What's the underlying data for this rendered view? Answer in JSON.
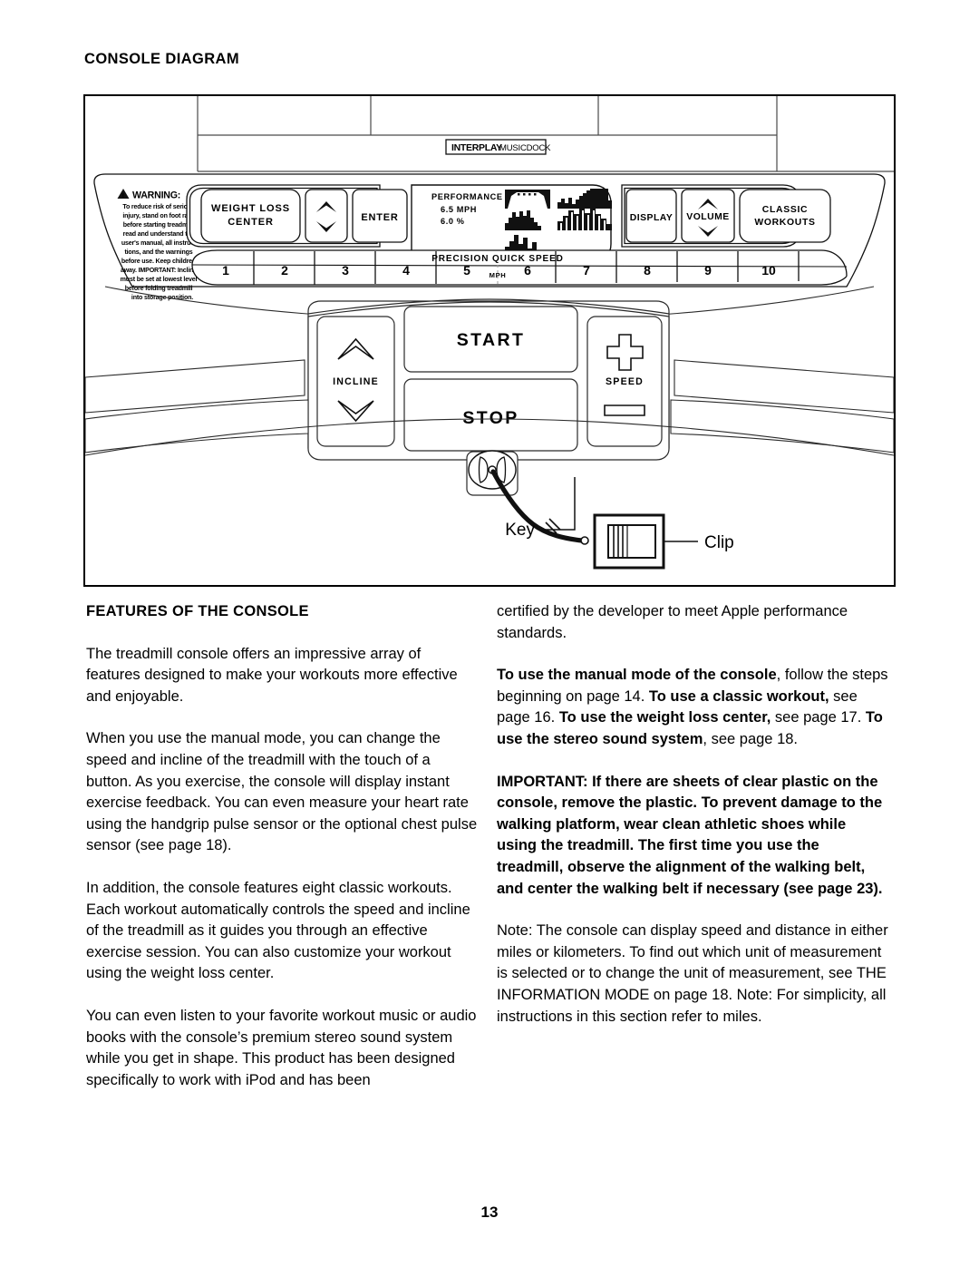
{
  "section_title": "CONSOLE DIAGRAM",
  "page_number": "13",
  "diagram": {
    "brand_logo": {
      "primary": "INTERPLAY",
      "secondary": "MUSICDOCK"
    },
    "warning": {
      "title": "WARNING:",
      "body": "To reduce risk of serious injury, stand on foot rails before starting treadmill, read and understand the user's manual, all instructions, and the warnings before use. Keep children away. IMPORTANT: Incline must be set at lowest level before folding treadmill into storage position.",
      "lines": [
        "To reduce risk of serious",
        "injury, stand on foot rails",
        "before starting treadmill,",
        "read and understand the",
        "user's manual, all instruc-",
        "tions, and the warnings",
        "before use.  Keep children",
        "away.  IMPORTANT: Incline",
        "must be set at lowest level",
        "before folding treadmill",
        "into storage position."
      ]
    },
    "buttons": {
      "weight_loss_center_line1": "WEIGHT LOSS",
      "weight_loss_center_line2": "CENTER",
      "enter": "ENTER",
      "display": "DISPLAY",
      "volume": "VOLUME",
      "classic_workouts_line1": "CLASSIC",
      "classic_workouts_line2": "WORKOUTS",
      "start": "START",
      "stop": "STOP",
      "incline": "INCLINE",
      "speed": "SPEED"
    },
    "display_screen": {
      "mode_label": "PERFORMANCE",
      "speed_value": "6.5 MPH",
      "incline_value": "6.0 %"
    },
    "quick_speed": {
      "label": "PRECISION QUICK SPEED",
      "unit": "MPH",
      "keys": [
        "1",
        "2",
        "3",
        "4",
        "5",
        "6",
        "7",
        "8",
        "9",
        "10"
      ]
    },
    "callouts": {
      "key": "Key",
      "clip": "Clip"
    }
  },
  "content": {
    "left_heading": "FEATURES OF THE CONSOLE",
    "left_paragraphs": [
      "The treadmill console offers an impressive array of features designed to make your workouts more effective and enjoyable.",
      "When you use the manual mode, you can change the speed and incline of the treadmill with the touch of a button. As you exercise, the console will display instant exercise feedback. You can even measure your heart rate using the handgrip pulse sensor or the optional chest pulse sensor (see page 18).",
      "In addition, the console features eight classic workouts. Each workout automatically controls the speed and incline of the treadmill as it guides you through an effective exercise session. You can also customize your workout using the weight loss center.",
      "You can even listen to your favorite workout music or audio books with the console’s premium stereo sound system while you get in shape. This product has been designed specifically to work with iPod and has been"
    ],
    "right_paragraph_continuation": "certified by the developer to meet Apple performance standards.",
    "right_modes": {
      "b1": "To use the manual mode of the console",
      "t1": ", follow the steps beginning on page 14. ",
      "b2": "To use a classic workout,",
      "t2": " see page 16. ",
      "b3": "To use the weight loss center,",
      "t3": " see page 17. ",
      "b4": "To use the stereo sound system",
      "t4": ", see page 18."
    },
    "right_important": "IMPORTANT: If there are sheets of clear plastic on the console, remove the plastic. To prevent damage to the walking platform, wear clean athletic shoes while using the treadmill. The first time you use the treadmill, observe the alignment of the walking belt, and center the walking belt if necessary (see page 23).",
    "right_note": "Note: The console can display speed and distance in either miles or kilometers. To find out which unit of measurement is selected or to change the unit of measurement, see THE INFORMATION MODE on page 18. Note: For simplicity, all instructions in this section refer to miles."
  }
}
